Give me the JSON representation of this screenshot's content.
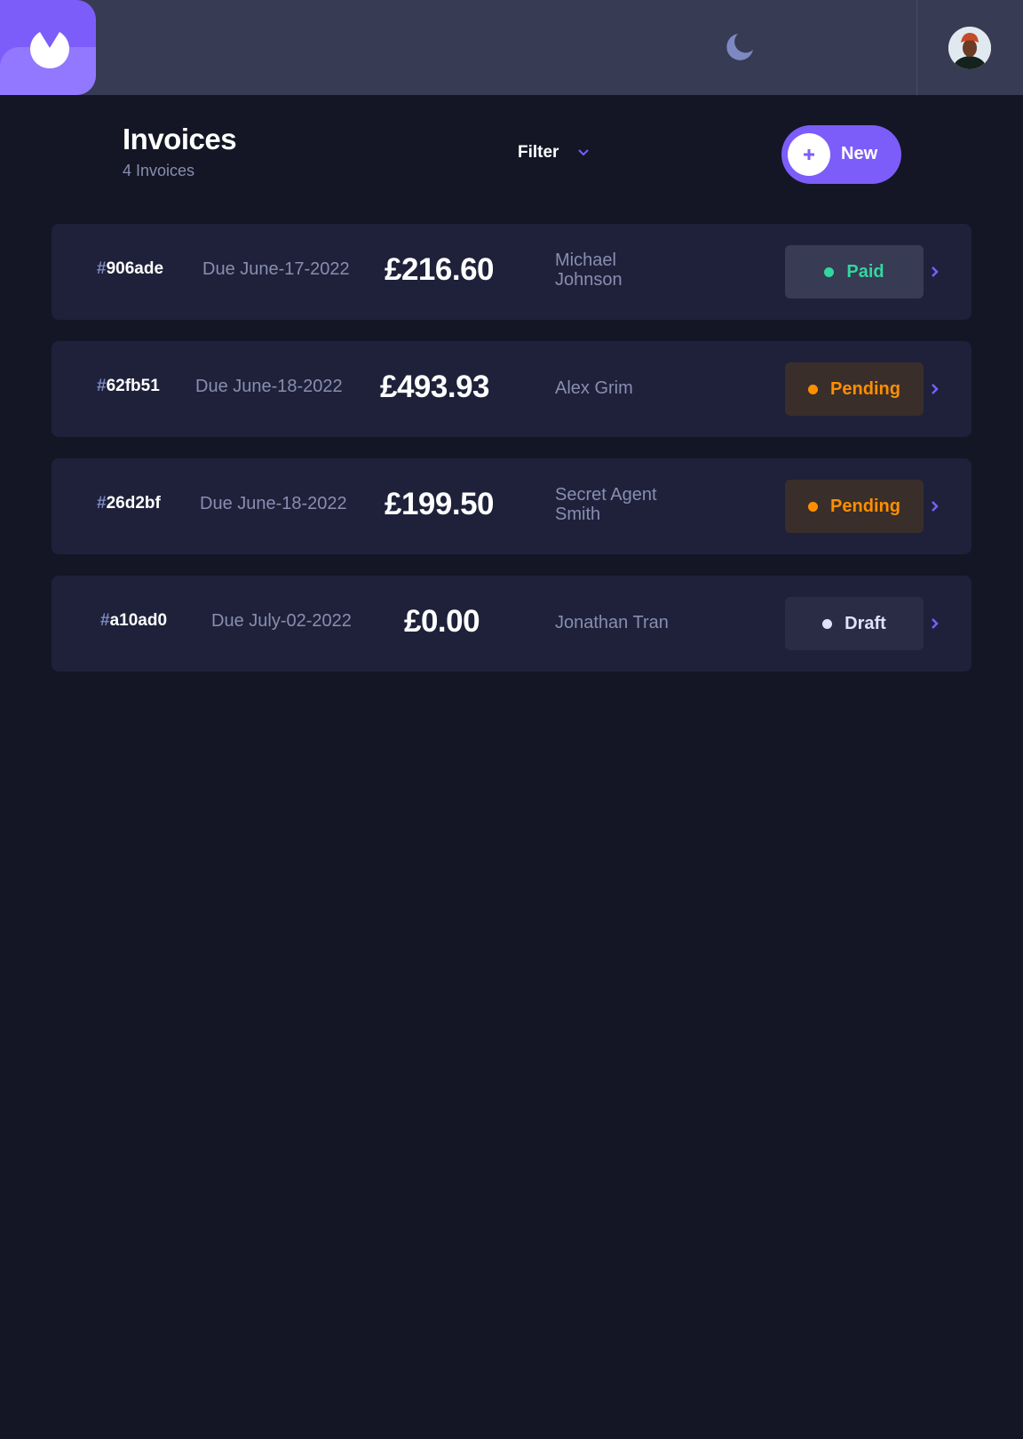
{
  "header": {
    "logo_icon": "brand-logo-icon",
    "theme_icon": "moon-icon",
    "avatar_icon": "user-avatar"
  },
  "invoices_header": {
    "title": "Invoices",
    "count_text": "4 Invoices",
    "filter_label": "Filter",
    "new_label": "New"
  },
  "invoices": [
    {
      "hash": "#",
      "id": "906ade",
      "due": "Due June-17-2022",
      "amount": "£216.60",
      "client": "Michael Johnson",
      "status": "Paid"
    },
    {
      "hash": "#",
      "id": "62fb51",
      "due": "Due June-18-2022",
      "amount": "£493.93",
      "client": "Alex Grim",
      "status": "Pending"
    },
    {
      "hash": "#",
      "id": "26d2bf",
      "due": "Due June-18-2022",
      "amount": "£199.50",
      "client": "Secret Agent Smith",
      "status": "Pending"
    },
    {
      "hash": "#",
      "id": "a10ad0",
      "due": "Due July-02-2022",
      "amount": "£0.00",
      "client": "Jonathan Tran",
      "status": "Draft"
    }
  ],
  "colors": {
    "background": "#141625",
    "topbar": "#373b53",
    "accent": "#7c5dfa",
    "card": "#1e2139",
    "paid": "#33d69f",
    "pending": "#ff8f00",
    "draft": "#dfe3fa"
  }
}
